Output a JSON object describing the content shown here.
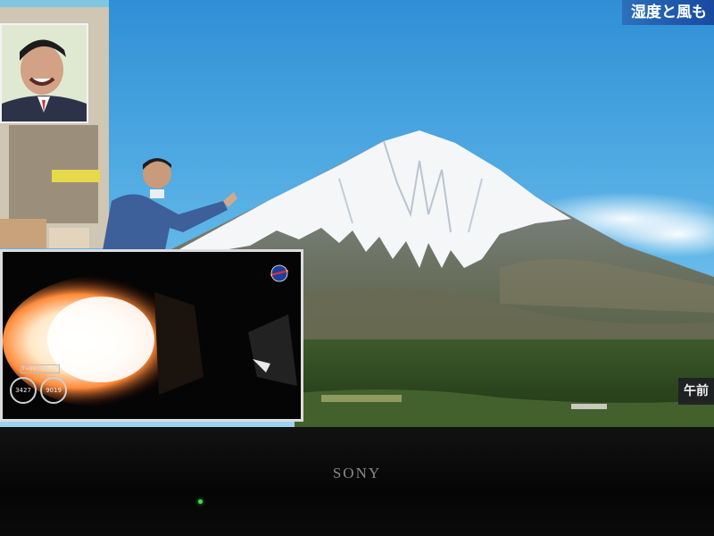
{
  "broadcast": {
    "caption": "湿度と風も",
    "time_tag": "午前",
    "inset_met": "T+00:04:16",
    "gauge_left": "3427",
    "gauge_right": "9019"
  },
  "tv": {
    "brand": "SONY"
  },
  "colors": {
    "sky": "#4aa6de",
    "caption_bg": "#1f4f9e",
    "led": "#35e04a"
  },
  "icons": {
    "nasa_logo": "nasa-logo-icon"
  }
}
